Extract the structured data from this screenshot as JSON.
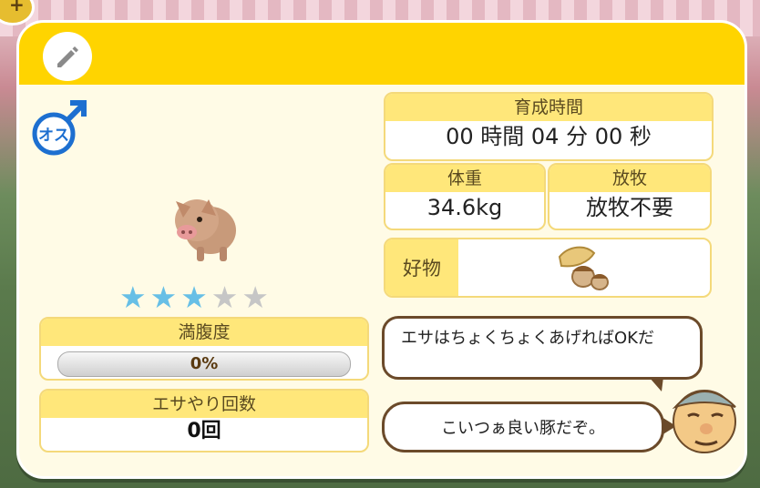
{
  "header": {
    "edit_icon": "pencil-icon"
  },
  "pig": {
    "gender_label": "オス",
    "gender_icon": "male-symbol-icon",
    "rating": 3,
    "rating_max": 5
  },
  "stats": {
    "hunger_label": "満腹度",
    "hunger_value": "0%",
    "hunger_fraction": 0,
    "feed_count_label": "エサやり回数",
    "feed_count_value": "0回",
    "growth_time_label": "育成時間",
    "growth_time_value": "00 時間 04 分 00 秒",
    "weight_label": "体重",
    "weight_value": "34.6kg",
    "grazing_label": "放牧",
    "grazing_value": "放牧不要",
    "favorite_label": "好物",
    "favorite_icon": "acorn-icon"
  },
  "dialogue": {
    "line1": "エサはちょくちょくあげればOKだ",
    "line2": "こいつぁ良い豚だぞ。"
  },
  "colors": {
    "header": "#ffd400",
    "label_bg": "#ffe77a",
    "star_on": "#67bfe6",
    "star_off": "#c6c6c6"
  }
}
